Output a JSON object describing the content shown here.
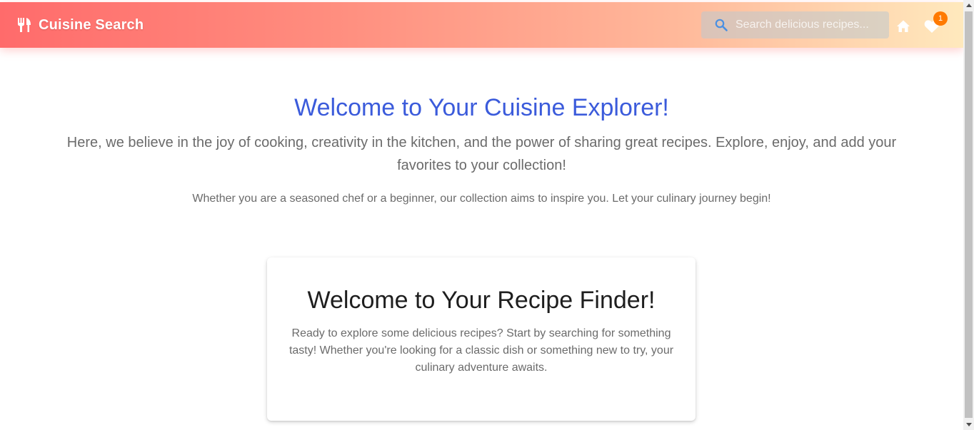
{
  "header": {
    "brand_name": "Cuisine Search",
    "brand_icon": "utensils-icon",
    "search": {
      "placeholder": "Search delicious recipes...",
      "value": ""
    },
    "home_icon": "home-icon",
    "favorites_icon": "heart-icon",
    "favorites_count": "1"
  },
  "intro": {
    "title": "Welcome to Your Cuisine Explorer!",
    "lead": "Here, we believe in the joy of cooking, creativity in the kitchen, and the power of sharing great recipes. Explore, enjoy, and add your favorites to your collection!",
    "sub": "Whether you are a seasoned chef or a beginner, our collection aims to inspire you. Let your culinary journey begin!"
  },
  "card": {
    "title": "Welcome to Your Recipe Finder!",
    "text": "Ready to explore some delicious recipes? Start by searching for something tasty! Whether you're looking for a classic dish or something new to try, your culinary adventure awaits."
  },
  "colors": {
    "header_start": "#ff6b6b",
    "header_end": "#ffe9bd",
    "accent_title": "#3b5bdb",
    "badge": "#ff7a00"
  }
}
